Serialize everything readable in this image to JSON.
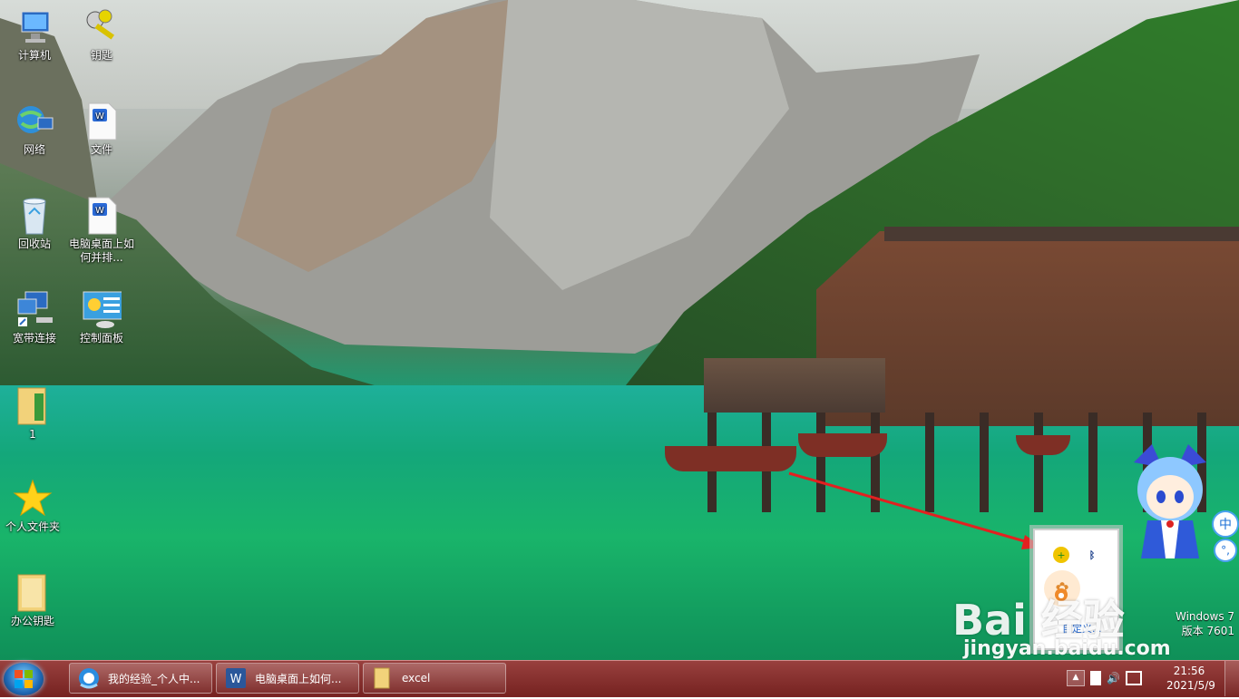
{
  "desktop_icons": [
    {
      "label": "计算机",
      "icon": "computer-icon"
    },
    {
      "label": "钥匙",
      "icon": "key-icon"
    },
    {
      "label": "网络",
      "icon": "network-icon"
    },
    {
      "label": "文件",
      "icon": "wps-doc-icon"
    },
    {
      "label": "回收站",
      "icon": "recycle-bin-icon"
    },
    {
      "label": "电脑桌面上如何并排...",
      "icon": "wps-doc-icon"
    },
    {
      "label": "宽带连接",
      "icon": "broadband-icon"
    },
    {
      "label": "控制面板",
      "icon": "control-panel-icon"
    },
    {
      "label": "1",
      "icon": "folder-icon"
    },
    {
      "label": "个人文件夹",
      "icon": "star-folder-icon"
    },
    {
      "label": "办公钥匙",
      "icon": "folder-icon"
    }
  ],
  "taskbar": {
    "buttons": [
      {
        "label": "我的经验_个人中...",
        "icon": "browser-icon"
      },
      {
        "label": "电脑桌面上如何...",
        "icon": "word-icon"
      },
      {
        "label": "excel",
        "icon": "folder-icon"
      }
    ],
    "tray_icons": [
      "show-hidden-icons-icon",
      "flag-icon",
      "volume-icon",
      "network-tray-icon"
    ],
    "clock": {
      "time": "21:56",
      "date": "2021/5/9"
    }
  },
  "tray_popup": {
    "icons": [
      "green-plus-icon",
      "bluetooth-icon",
      "paw-icon",
      "orange-badge-icon"
    ],
    "link_text": "自定义..."
  },
  "watermark": {
    "brand": "Bai 经验",
    "url": "jingyan.baidu.com"
  },
  "os_version": {
    "line1": "Windows 7",
    "line2": "版本 7601"
  },
  "ime": {
    "mode": "中",
    "extra": "°,"
  },
  "colors": {
    "taskbar": "#8f2f2f",
    "arrow": "#e32020",
    "lake": "#14a77a"
  }
}
